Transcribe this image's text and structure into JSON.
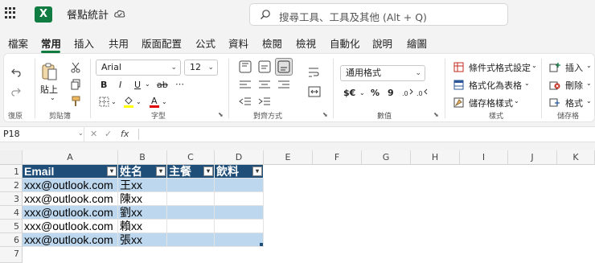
{
  "app": {
    "title": "餐點統計",
    "logo": "X"
  },
  "search": {
    "placeholder": "搜尋工具、工具及其他 (Alt + Q)"
  },
  "tabs": [
    {
      "label": "檔案"
    },
    {
      "label": "常用"
    },
    {
      "label": "插入"
    },
    {
      "label": "共用"
    },
    {
      "label": "版面配置"
    },
    {
      "label": "公式"
    },
    {
      "label": "資料"
    },
    {
      "label": "檢閱"
    },
    {
      "label": "檢視"
    },
    {
      "label": "自動化"
    },
    {
      "label": "說明"
    },
    {
      "label": "繪圖"
    }
  ],
  "ribbon": {
    "undo_group": "復原",
    "clipboard": {
      "paste": "貼上",
      "group": "剪貼簿"
    },
    "font": {
      "name": "Arial",
      "size": "12",
      "group": "字型"
    },
    "alignment": {
      "group": "對齊方式"
    },
    "number": {
      "format": "通用格式",
      "group": "數值",
      "currency": "$€",
      "percent": "%",
      "comma": "9"
    },
    "styles": {
      "conditional": "條件式格式設定",
      "as_table": "格式化為表格",
      "cell_styles": "儲存格樣式",
      "group": "樣式"
    },
    "cells": {
      "insert": "插入",
      "delete": "刪除",
      "format": "格式",
      "group": "儲存格"
    }
  },
  "formula_bar": {
    "name_box": "P18",
    "fx": "fx",
    "value": ""
  },
  "sheet": {
    "columns": [
      "A",
      "B",
      "C",
      "D",
      "E",
      "F",
      "G",
      "H",
      "I",
      "J",
      "K"
    ],
    "rows": [
      "1",
      "2",
      "3",
      "4",
      "5",
      "6",
      "7"
    ],
    "headers": [
      "Email",
      "姓名",
      "主餐",
      "飲料"
    ],
    "data": [
      [
        "xxx@outlook.com",
        "王xx",
        "",
        ""
      ],
      [
        "xxx@outlook.com",
        "陳xx",
        "",
        ""
      ],
      [
        "xxx@outlook.com",
        "劉xx",
        "",
        ""
      ],
      [
        "xxx@outlook.com",
        "賴xx",
        "",
        ""
      ],
      [
        "xxx@outlook.com",
        "張xx",
        "",
        ""
      ]
    ]
  },
  "colors": {
    "accent": "#107c41",
    "table_header": "#1f4e79",
    "band": "#bdd7ee"
  }
}
